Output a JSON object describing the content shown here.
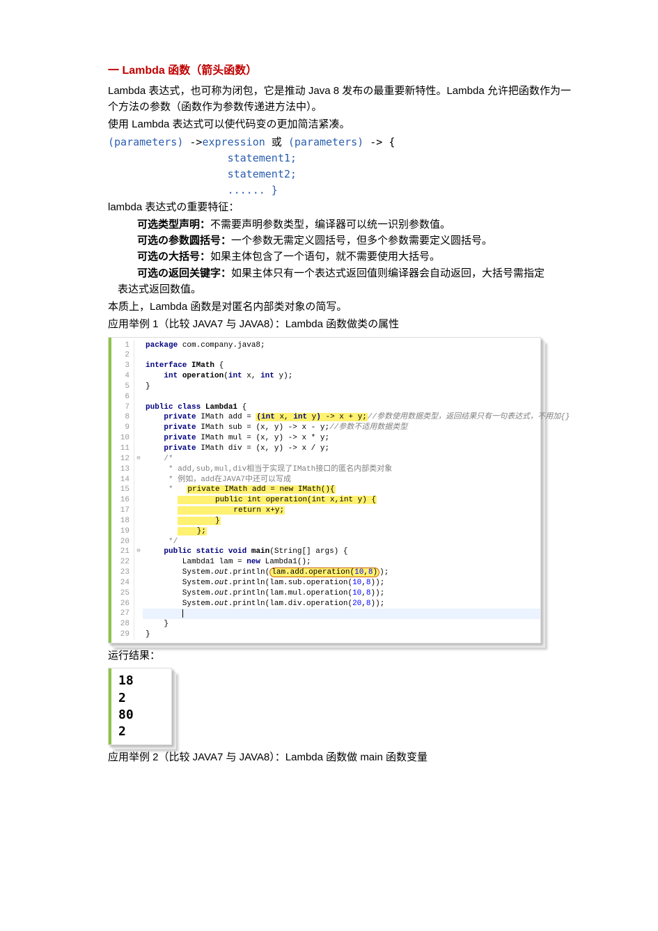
{
  "title": "一 Lambda 函数（箭头函数）",
  "intro1": "Lambda 表达式，也可称为闭包，它是推动 Java 8 发布の最重要新特性。Lambda 允许把函数作为一个方法の参数（函数作为参数传递进方法中）。",
  "intro2": "使用 Lambda 表达式可以使代码变の更加简洁紧凑。",
  "syntax": {
    "l1_a": "(parameters)",
    "l1_b": " ->",
    "l1_c": "expression",
    "l1_d": " 或 ",
    "l1_e": "(parameters)",
    "l1_f": " -> {",
    "l2": "                   statement1;",
    "l3": "                   statement2;",
    "l4": "                   ...... }"
  },
  "feat_title": "lambda 表达式の重要特征：",
  "feat1_lead": "可选类型声明：",
  "feat1_body": "不需要声明参数类型，编译器可以统一识别参数值。",
  "feat2_lead": "可选の参数圆括号：",
  "feat2_body": "一个参数无需定义圆括号，但多个参数需要定义圆括号。",
  "feat3_lead": "可选の大括号：",
  "feat3_body": "如果主体包含了一个语句，就不需要使用大括号。",
  "feat4_lead": "可选の返回关键字：",
  "feat4_body": "如果主体只有一个表达式返回值则编译器会自动返回，大括号需指定",
  "feat4_cont": "表达式返回数值。",
  "essence": "本质上，Lambda 函数是对匿名内部类对象の简写。",
  "example1_title": "应用举例 1（比较 JAVA7 与 JAVA8）：Lambda 函数做类の属性",
  "code": {
    "lines": [
      {
        "n": "1",
        "g": "",
        "pkg": true,
        "t": "package com.company.java8;"
      },
      {
        "n": "2",
        "g": "",
        "t": ""
      },
      {
        "n": "3",
        "g": "",
        "t": "interface IMath {",
        "iface": true
      },
      {
        "n": "4",
        "g": "",
        "t": "    int operation(int x, int y);",
        "meth": true
      },
      {
        "n": "5",
        "g": "",
        "t": "}"
      },
      {
        "n": "6",
        "g": "",
        "t": ""
      },
      {
        "n": "7",
        "g": "",
        "t": "public class Lambda1 {",
        "cls": true
      },
      {
        "n": "8",
        "g": "",
        "hl": "add",
        "t": "    private IMath add = (int x, int y) -> x + y;",
        "c": "//参数使用数据类型，返回结果只有一句表达式，不用加{}"
      },
      {
        "n": "9",
        "g": "",
        "t": "    private IMath sub = (x, y) -> x - y;",
        "c": "//参数不适用数据类型"
      },
      {
        "n": "10",
        "g": "",
        "t": "    private IMath mul = (x, y) -> x * y;"
      },
      {
        "n": "11",
        "g": "",
        "t": "    private IMath div = (x, y) -> x / y;"
      },
      {
        "n": "12",
        "g": "⊖",
        "t": "    /*"
      },
      {
        "n": "13",
        "g": "",
        "t": "     * add,sub,mul,div相当于实现了IMath接口的匿名内部类对象"
      },
      {
        "n": "14",
        "g": "",
        "t": "     * 例如，add在JAVA7中还可以写成"
      },
      {
        "n": "15",
        "g": "",
        "t": "     *   private IMath add = new IMath(){",
        "hlc": true
      },
      {
        "n": "16",
        "g": "",
        "t": "               public int operation(int x,int y) {",
        "hlc": true
      },
      {
        "n": "17",
        "g": "",
        "t": "                   return x+y;",
        "hlc": true
      },
      {
        "n": "18",
        "g": "",
        "t": "               }",
        "hlc": true
      },
      {
        "n": "19",
        "g": "",
        "t": "           };",
        "hlc": true
      },
      {
        "n": "20",
        "g": "",
        "t": "     */"
      },
      {
        "n": "21",
        "g": "⊖",
        "t": "    public static void main(String[] args) {",
        "main": true
      },
      {
        "n": "22",
        "g": "",
        "t": "        Lambda1 lam = new Lambda1();"
      },
      {
        "n": "23",
        "g": "",
        "t": "        System.out.println(lam.add.operation(10,8));",
        "ring": true
      },
      {
        "n": "24",
        "g": "",
        "t": "        System.out.println(lam.sub.operation(10,8));"
      },
      {
        "n": "25",
        "g": "",
        "t": "        System.out.println(lam.mul.operation(10,8));"
      },
      {
        "n": "26",
        "g": "",
        "t": "        System.out.println(lam.div.operation(20,8));"
      },
      {
        "n": "27",
        "g": "",
        "t": "        ",
        "cursor": true
      },
      {
        "n": "28",
        "g": "",
        "t": "    }"
      },
      {
        "n": "29",
        "g": "",
        "t": "}"
      }
    ]
  },
  "result_title": "运行结果：",
  "results": [
    "18",
    "2",
    "80",
    "2"
  ],
  "example2_title": "应用举例 2（比较 JAVA7 与 JAVA8）：Lambda 函数做 main 函数变量"
}
